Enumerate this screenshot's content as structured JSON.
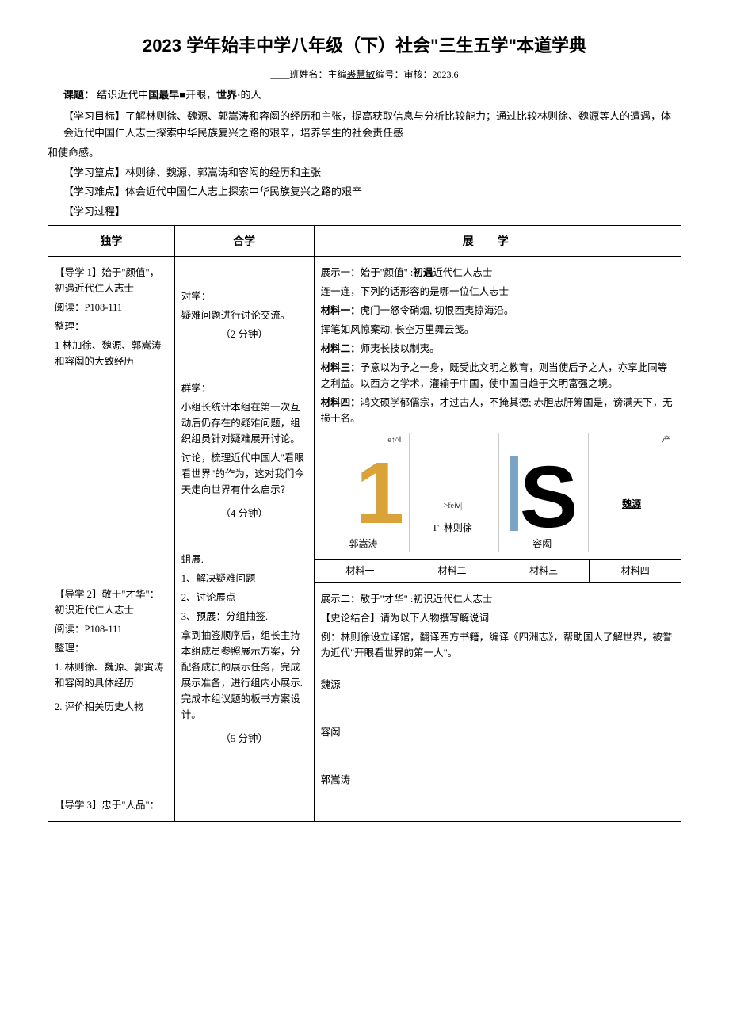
{
  "header": {
    "title": "2023 学年始丰中学八年级（下）社会\"三生五学\"本道学典",
    "subtitle_prefix": "____班姓名：主编",
    "editor": "裘慧敏",
    "subtitle_suffix": "编号：审核：2023.6"
  },
  "topic": {
    "label": "课题：",
    "text_a": "结识近代中",
    "text_b": "国最早",
    "text_c": "■开眼，",
    "text_d": "世界·",
    "text_e": "的人"
  },
  "goals": {
    "label": "【学习目标】",
    "text": "了解林则徐、魏源、郭嵩涛和容闳的经历和主张，提高获取信息与分析比较能力；通过比较林则徐、魏源等人的遭遇，体会近代中国仁人志士探索中华民族复兴之路的艰辛，培养学生的社会责任感",
    "text2": "和使命感。"
  },
  "keypoint": {
    "label": "【学习篁点】",
    "text": "林则徐、魏源、郭嵩涛和容闳的经历和主张"
  },
  "difficulty": {
    "label": "【学习难点】",
    "text": "体会近代中国仁人志上探索中华民族复兴之路的艰辛"
  },
  "process_label": "【学习过程】",
  "table": {
    "headers": {
      "h1": "独学",
      "h2": "合学",
      "h3": "展学"
    },
    "col1": {
      "d1_title": "【导学 1】始于\"颜值\"，初遇近代仁人志士",
      "d1_read": "阅读：P108-111",
      "d1_sort": "整理：",
      "d1_item": "1 林加徐、魏源、郭嵩涛和容闳的大致经历",
      "d2_title": "【导学 2】敬于\"才华\"：初识近代仁人志士",
      "d2_read": "阅读：P108-111",
      "d2_sort": "整理：",
      "d2_item1": "1. 林则徐、魏源、郭寅涛和容闳的具体经历",
      "d2_item2": "2. 评价相关历史人物",
      "d3_title": "【导学 3】忠于\"人品\"："
    },
    "col2": {
      "dui_label": "对学：",
      "dui_text": "疑难问题进行讨论交流。",
      "dui_time": "（2 分钟）",
      "qun_label": "群学：",
      "qun_text1": "小组长统计本组在第一次互动后仍存在的疑难问题，组织组员针对疑难展开讨论。",
      "qun_text2": "讨论，梳理近代中国人\"看眼看世界\"的作为，这对我们今天走向世界有什么启示？",
      "qun_time": "（4 分钟）",
      "zu_label": "蛆展.",
      "zu_1": "1、解决疑难问题",
      "zu_2": "2、讨论展点",
      "zu_3": "3、预展：分组抽签.",
      "zu_text": "拿到抽签顺序后，组长主持本组成员参照展示方案，分配各成员的展示任务，完成展示准备，进行组内小展示. 完成本组议题的板书方案设计。",
      "zu_time": "（5 分钟）"
    },
    "col3": {
      "z1_title": "展示一：始于\"颜值\" :",
      "z1_title_b": "初遇",
      "z1_title_c": "近代仁人志士",
      "z1_line": "连一连，下列的话形容的是哪一位仁人志士",
      "m1_label": "材料一：",
      "m1_text": "虎门一怒令硝烟, 切恨西夷掠海沿。",
      "m1_text2": "挥笔如风惊案动, 长空万里舞云笺。",
      "m2_label": "材料二：",
      "m2_text": "师夷长技以制夷。",
      "m3_label": "材料三：",
      "m3_text": "予意以为予之一身，既受此文明之教育，则当使后予之人，亦享此同等之利益。以西方之学术，灌输于中国，使中国日趋于文明富强之境。",
      "m4_label": "材料四：",
      "m4_text": "鸿文硕学郁儒宗，才过古人，不掩其德; 赤胆忠肝筹国是，谤满天下，无损于名。",
      "img1_cap": "郭嵩涛",
      "img1_tag": "e↑^Ⅰ",
      "img2_cap": "林则徐",
      "img2_tag": ">feⅳ|",
      "img2_pre": "Γ",
      "img3_cap": "容闳",
      "img4_cap": "魏源",
      "img4_tag": "产",
      "mat1": "材料一",
      "mat2": "材料二",
      "mat3": "材料三",
      "mat4": "材料四",
      "z2_title": "展示二：敬于\"才华\" :初识近代仁人志士",
      "z2_task": "【史论结合】请为以下人物撰写解说词",
      "z2_example": "例：林则徐设立译馆，翻译西方书籍，编译《四洲志》，帮助国人了解世界，被誉为近代\"开眼看世界的第一人\"。",
      "name1": "魏源",
      "name2": "容闳",
      "name3": "郭嵩涛"
    }
  }
}
